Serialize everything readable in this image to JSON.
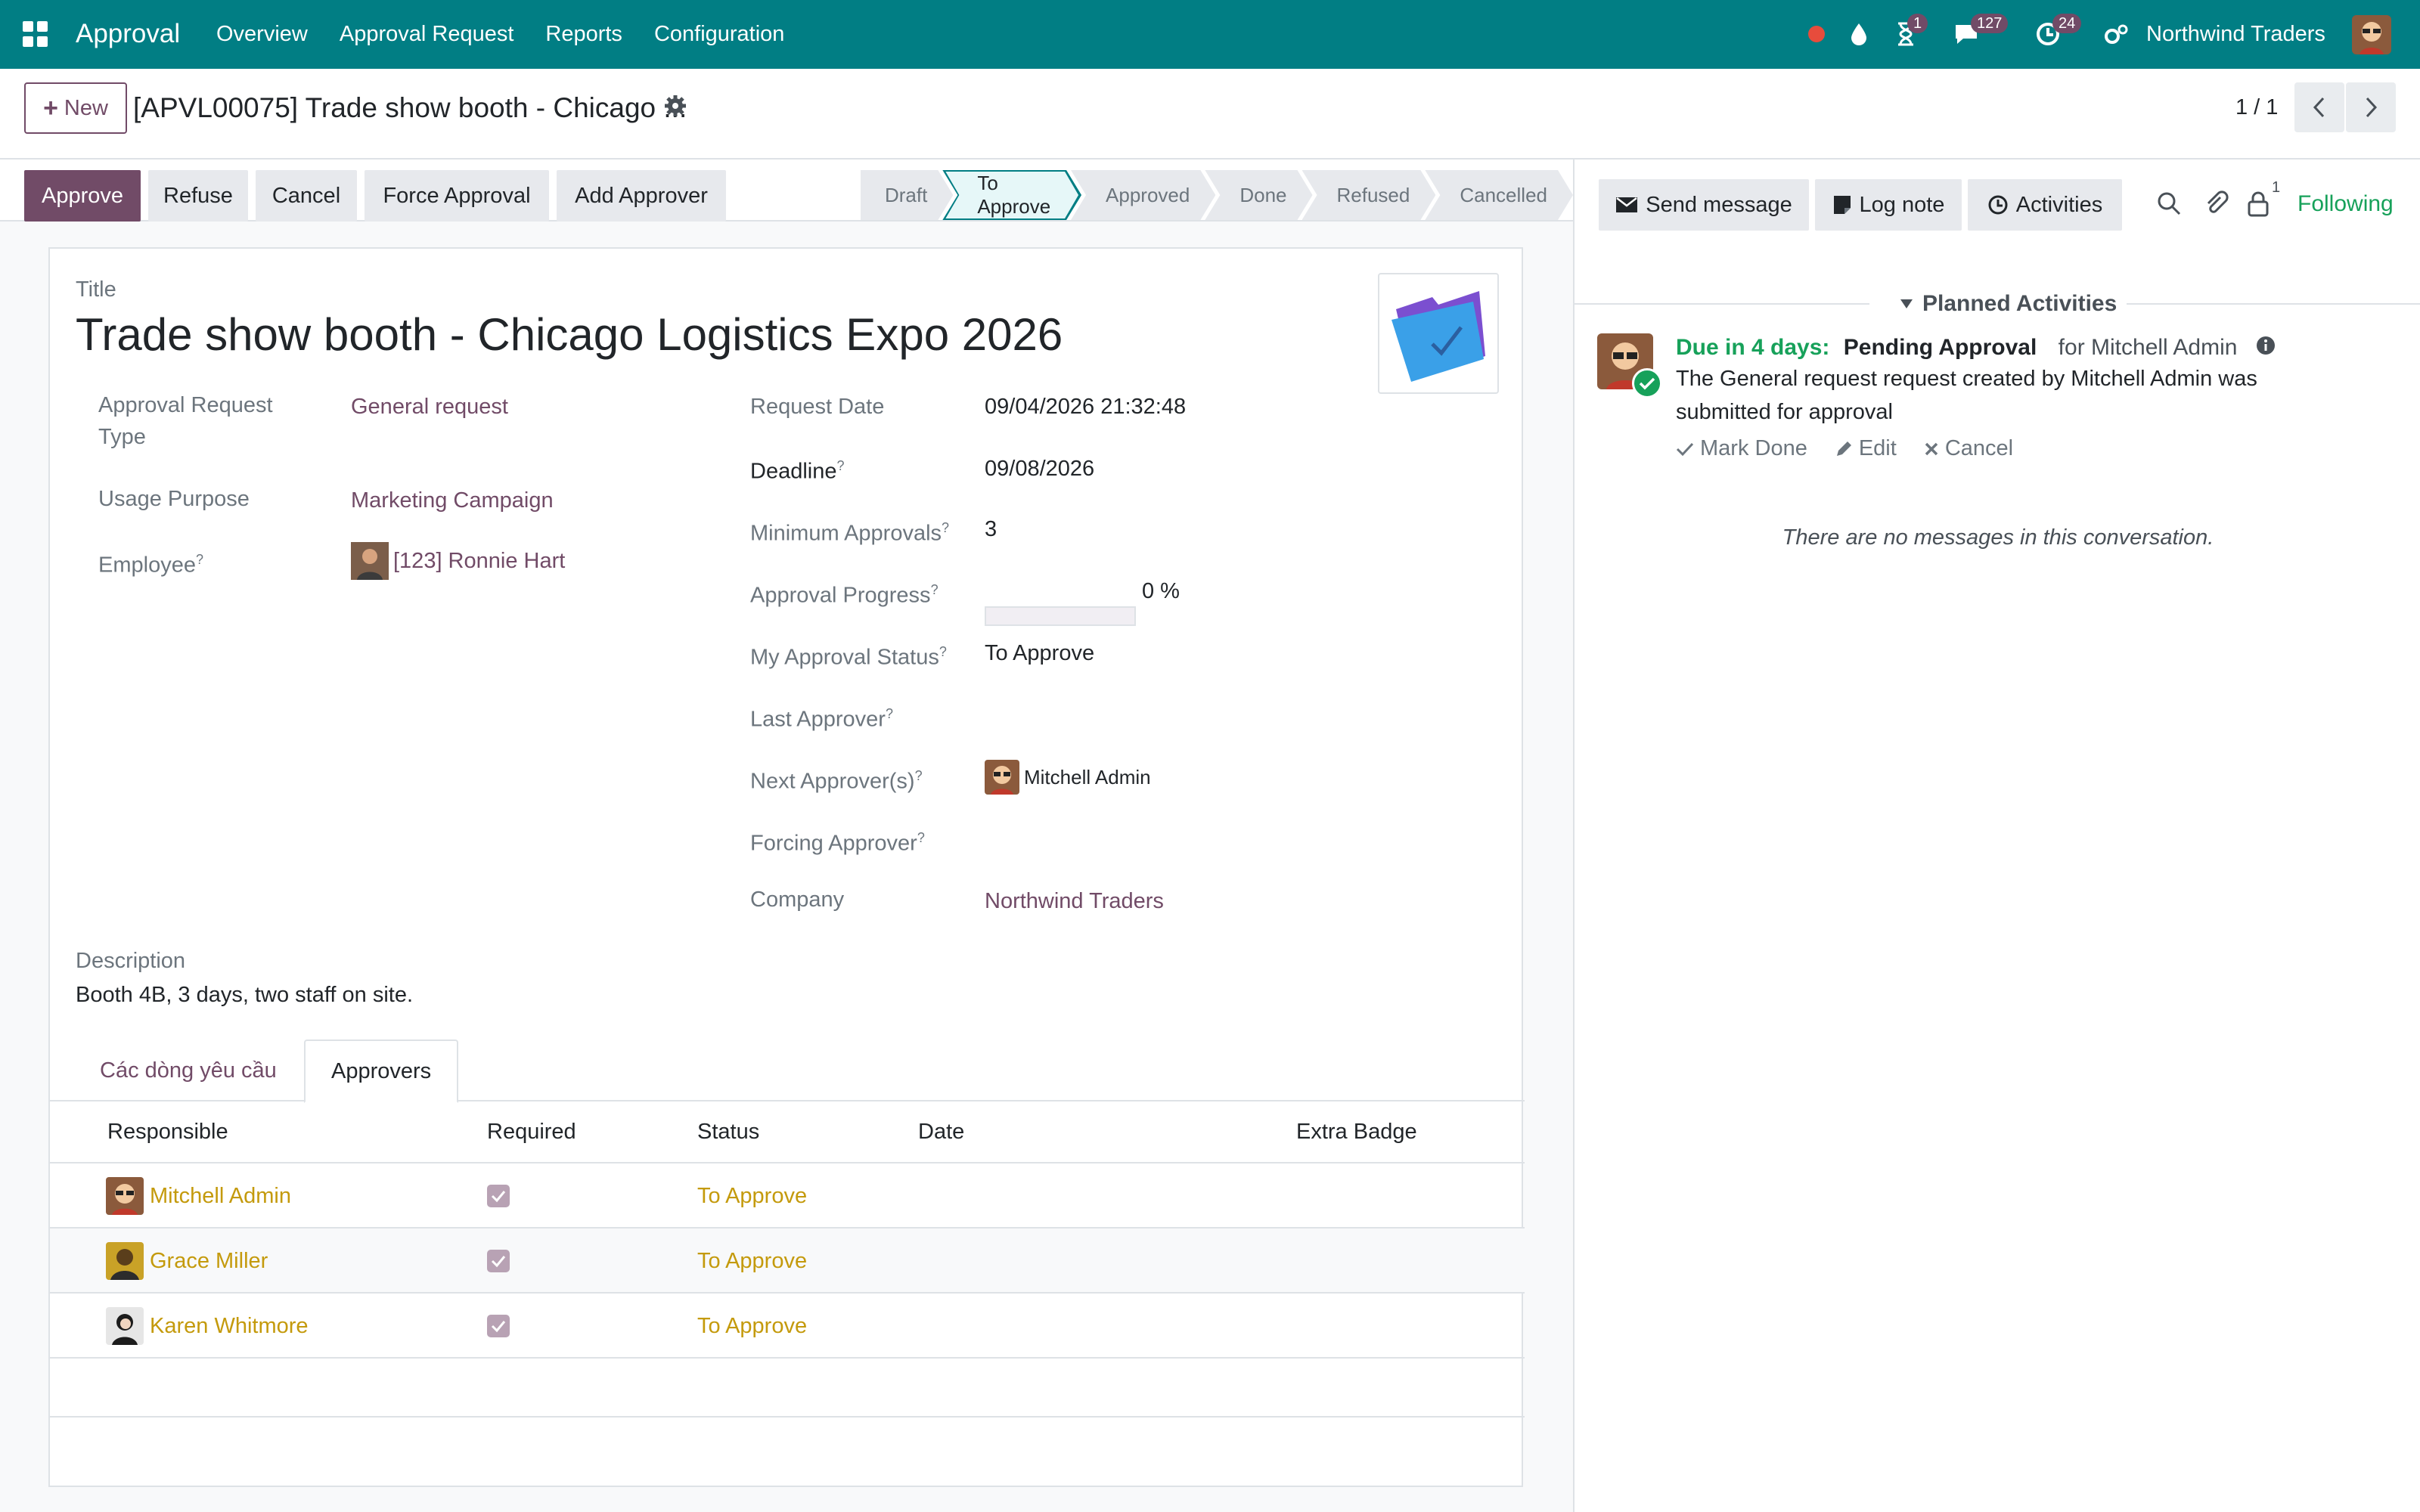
{
  "navbar": {
    "brand": "Approval",
    "menu": [
      "Overview",
      "Approval Request",
      "Reports",
      "Configuration"
    ],
    "badges": {
      "activities": "1",
      "messages": "127",
      "clock": "24"
    },
    "company": "Northwind Traders"
  },
  "control": {
    "new_label": "New",
    "record_title": "[APVL00075] Trade show booth - Chicago ...",
    "pager": "1 / 1"
  },
  "actions": {
    "approve": "Approve",
    "refuse": "Refuse",
    "cancel": "Cancel",
    "force": "Force Approval",
    "add_approver": "Add Approver"
  },
  "stages": [
    "Draft",
    "To Approve",
    "Approved",
    "Done",
    "Refused",
    "Cancelled"
  ],
  "form": {
    "title_label": "Title",
    "title": "Trade show booth - Chicago Logistics Expo 2026",
    "left": {
      "request_type_label_1": "Approval Request",
      "request_type_label_2": "Type",
      "request_type": "General request",
      "usage_label": "Usage Purpose",
      "usage": "Marketing Campaign",
      "employee_label": "Employee",
      "employee": "[123] Ronnie Hart"
    },
    "right": {
      "request_date_label": "Request Date",
      "request_date": "09/04/2026 21:32:48",
      "deadline_label": "Deadline",
      "deadline": "09/08/2026",
      "min_approvals_label": "Minimum Approvals",
      "min_approvals": "3",
      "progress_label": "Approval Progress",
      "progress_text": "0 %",
      "progress_value": 0,
      "my_status_label": "My Approval Status",
      "my_status": "To Approve",
      "last_approver_label": "Last Approver",
      "next_approver_label": "Next Approver(s)",
      "next_approver": "Mitchell Admin",
      "forcing_label": "Forcing Approver",
      "company_label": "Company",
      "company": "Northwind Traders"
    },
    "help_mark": "?",
    "description_label": "Description",
    "description": "Booth 4B, 3 days, two staff on site."
  },
  "tabs": [
    "Các dòng yêu cầu",
    "Approvers"
  ],
  "approvers_table": {
    "headers": [
      "Responsible",
      "Required",
      "Status",
      "Date",
      "Extra Badge"
    ],
    "rows": [
      {
        "responsible": "Mitchell Admin",
        "status": "To Approve"
      },
      {
        "responsible": "Grace Miller",
        "status": "To Approve"
      },
      {
        "responsible": "Karen Whitmore",
        "status": "To Approve"
      }
    ]
  },
  "chatter": {
    "send_message": "Send message",
    "log_note": "Log note",
    "activities": "Activities",
    "followers_count": "1",
    "following": "Following",
    "planned_title": "Planned Activities",
    "activity": {
      "due": "Due in 4 days:",
      "type": "Pending Approval",
      "for": "for Mitchell Admin",
      "description": "The General request request created by Mitchell Admin was submitted for approval",
      "mark_done": "Mark Done",
      "edit": "Edit",
      "cancel": "Cancel"
    },
    "no_messages": "There are no messages in this conversation."
  },
  "colors": {
    "navbar": "#017e84",
    "primary": "#714b67",
    "success": "#17a15a",
    "warning_text": "#c49a0c"
  }
}
